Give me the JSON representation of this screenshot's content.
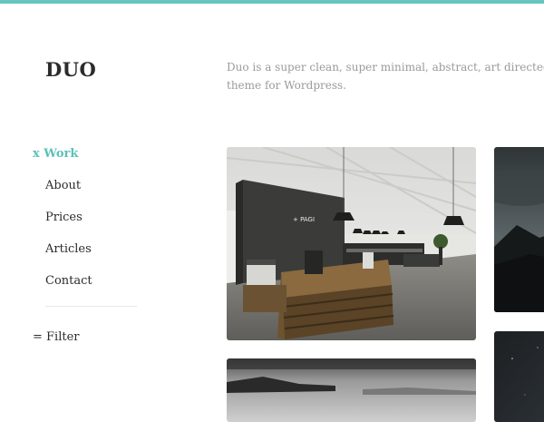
{
  "brand": {
    "name": "DUO",
    "accent_color": "#66c6bd"
  },
  "tagline": {
    "line1": "Duo is a super clean, super minimal, abstract, art directed",
    "line2": "theme for Wordpress."
  },
  "nav": {
    "items": [
      {
        "label": "x Work",
        "active": true
      },
      {
        "label": "About",
        "active": false
      },
      {
        "label": "Prices",
        "active": false
      },
      {
        "label": "Articles",
        "active": false
      },
      {
        "label": "Contact",
        "active": false
      }
    ],
    "filter_label": "= Filter"
  },
  "portfolio": {
    "tiles": [
      {
        "name": "office-interior",
        "wall_sign": "+ PAGI"
      },
      {
        "name": "dark-mountain-landscape"
      },
      {
        "name": "misty-shoreline"
      },
      {
        "name": "night-sky"
      }
    ]
  }
}
